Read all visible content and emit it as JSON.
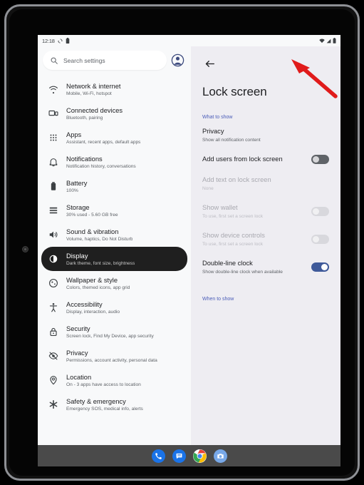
{
  "device": {
    "status_bar": {
      "time": "12:18",
      "icons": [
        "sync-icon",
        "battery-saver-icon",
        "wifi-icon",
        "signal-icon",
        "battery-icon"
      ]
    }
  },
  "sidebar": {
    "search": {
      "placeholder": "Search settings",
      "icon": "search-icon"
    },
    "avatar": "account-circle-icon",
    "items": [
      {
        "title": "Network & internet",
        "sub": "Mobile, Wi-Fi, hotspot",
        "icon": "wifi-icon",
        "selected": false
      },
      {
        "title": "Connected devices",
        "sub": "Bluetooth, pairing",
        "icon": "devices-icon",
        "selected": false
      },
      {
        "title": "Apps",
        "sub": "Assistant, recent apps, default apps",
        "icon": "apps-grid-icon",
        "selected": false
      },
      {
        "title": "Notifications",
        "sub": "Notification history, conversations",
        "icon": "bell-icon",
        "selected": false
      },
      {
        "title": "Battery",
        "sub": "100%",
        "icon": "battery-icon",
        "selected": false
      },
      {
        "title": "Storage",
        "sub": "30% used - 5.60 GB free",
        "icon": "storage-icon",
        "selected": false
      },
      {
        "title": "Sound & vibration",
        "sub": "Volume, haptics, Do Not Disturb",
        "icon": "volume-icon",
        "selected": false
      },
      {
        "title": "Display",
        "sub": "Dark theme, font size, brightness",
        "icon": "brightness-icon",
        "selected": true
      },
      {
        "title": "Wallpaper & style",
        "sub": "Colors, themed icons, app grid",
        "icon": "palette-icon",
        "selected": false
      },
      {
        "title": "Accessibility",
        "sub": "Display, interaction, audio",
        "icon": "accessibility-icon",
        "selected": false
      },
      {
        "title": "Security",
        "sub": "Screen lock, Find My Device, app security",
        "icon": "lock-icon",
        "selected": false
      },
      {
        "title": "Privacy",
        "sub": "Permissions, account activity, personal data",
        "icon": "eye-off-icon",
        "selected": false
      },
      {
        "title": "Location",
        "sub": "On - 3 apps have access to location",
        "icon": "location-pin-icon",
        "selected": false
      },
      {
        "title": "Safety & emergency",
        "sub": "Emergency SOS, medical info, alerts",
        "icon": "emergency-icon",
        "selected": false
      }
    ]
  },
  "detail": {
    "back_icon": "back-arrow-icon",
    "title": "Lock screen",
    "sections": [
      {
        "label": "What to show"
      },
      {
        "label": "When to show"
      }
    ],
    "preferences": [
      {
        "title": "Privacy",
        "sub": "Show all notification content",
        "control": "none",
        "state": "enabled"
      },
      {
        "title": "Add users from lock screen",
        "sub": "",
        "control": "switch",
        "switch_state": "off",
        "state": "enabled"
      },
      {
        "title": "Add text on lock screen",
        "sub": "None",
        "control": "none",
        "state": "disabled"
      },
      {
        "title": "Show wallet",
        "sub": "To use, first set a screen lock",
        "control": "switch",
        "switch_state": "disabled",
        "state": "disabled"
      },
      {
        "title": "Show device controls",
        "sub": "To use, first set a screen lock",
        "control": "switch",
        "switch_state": "disabled",
        "state": "disabled"
      },
      {
        "title": "Double-line clock",
        "sub": "Show double-line clock when available",
        "control": "switch",
        "switch_state": "on",
        "state": "enabled"
      }
    ],
    "annotation": {
      "type": "arrow",
      "color": "#e01b1b",
      "points_to": "Double-line clock toggle"
    }
  },
  "taskbar": {
    "apps": [
      {
        "name": "Phone",
        "icon": "phone-icon",
        "color": "#1a73e8"
      },
      {
        "name": "Messages",
        "icon": "messages-icon",
        "color": "#1a73e8"
      },
      {
        "name": "Chrome",
        "icon": "chrome-icon",
        "color": "#ffffff"
      },
      {
        "name": "Camera",
        "icon": "camera-icon",
        "color": "#78a8e8"
      }
    ]
  },
  "colors": {
    "sidebar_bg": "#f8f9fa",
    "detail_bg": "#eeedf2",
    "selected_pill": "#1f1f1f",
    "accent_blue": "#3f5a9a",
    "section_label": "#4a5cb8",
    "annotation_red": "#e01b1b"
  }
}
